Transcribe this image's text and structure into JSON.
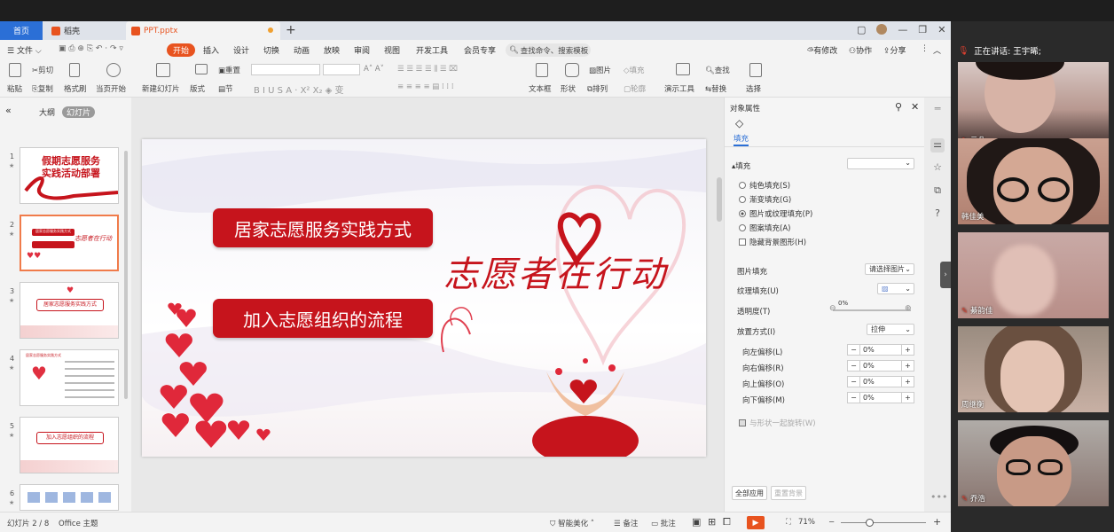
{
  "tabs": {
    "home": "首页",
    "daoke": "稻壳",
    "file": "PPT.pptx"
  },
  "menu": {
    "file": "文件",
    "items": [
      "开始",
      "插入",
      "设计",
      "切换",
      "动画",
      "放映",
      "审阅",
      "视图",
      "开发工具",
      "会员专享"
    ],
    "search": "查找命令、搜索模板",
    "right": [
      "有修改",
      "协作",
      "分享"
    ]
  },
  "ribbon": {
    "paste": "粘贴",
    "cut": "剪切",
    "copy": "复制",
    "format_painter": "格式刷",
    "from_current": "当页开始",
    "new_slide": "新建幻灯片",
    "layout": "版式",
    "section": "节",
    "reset": "重置",
    "textbox": "文本框",
    "shape": "形状",
    "arrange": "排列",
    "picture": "图片",
    "fill": "填充",
    "outline": "轮廓",
    "presenter": "演示工具",
    "find": "查找",
    "replace": "替换",
    "select": "选择"
  },
  "left": {
    "outline": "大纲",
    "slides": "幻灯片"
  },
  "thumbs": [
    {
      "num": "1",
      "t1": "假期志愿服务",
      "t2": "实践活动部署"
    },
    {
      "num": "2",
      "t1": "居家志愿服务实践方式",
      "t2": "志愿者在行动"
    },
    {
      "num": "3",
      "t1": "居家志愿服务实践方式"
    },
    {
      "num": "4",
      "t1": "居家志愿服务实践方式"
    },
    {
      "num": "5",
      "t1": "加入志愿组织的流程"
    },
    {
      "num": "6"
    }
  ],
  "slide": {
    "pill1": "居家志愿服务实践方式",
    "pill2": "加入志愿组织的流程",
    "calligraphy": "志愿者在行动"
  },
  "props": {
    "title": "对象属性",
    "tab_fill": "填充",
    "section_fill": "填充",
    "options": [
      "纯色填充(S)",
      "渐变填充(G)",
      "图片或纹理填充(P)",
      "图案填充(A)"
    ],
    "hide_bg": "隐藏背景图形(H)",
    "pic_fill": "图片填充",
    "pic_fill_value": "请选择图片",
    "texture_fill": "纹理填充(U)",
    "transparency": "透明度(T)",
    "transparency_value": "0%",
    "placement": "放置方式(I)",
    "placement_value": "拉伸",
    "offsets": [
      {
        "label": "向左偏移(L)",
        "value": "0%"
      },
      {
        "label": "向右偏移(R)",
        "value": "0%"
      },
      {
        "label": "向上偏移(O)",
        "value": "0%"
      },
      {
        "label": "向下偏移(M)",
        "value": "0%"
      }
    ],
    "rotate_with_shape": "与形状一起旋转(W)",
    "apply_all": "全部应用",
    "reset_bg": "重置背景"
  },
  "status": {
    "slide_info": "幻灯片 2 / 8",
    "theme": "Office 主题",
    "beautify": "智能美化",
    "notes": "备注",
    "comments": "批注",
    "zoom": "71%"
  },
  "meeting": {
    "speaking": "正在讲话: 王宇晞;",
    "participants": [
      "云朵",
      "韩佳美",
      "綦韵佳",
      "周继衡",
      "乔浩"
    ]
  },
  "colors": {
    "accent": "#e8531f",
    "slide_red": "#c6141c",
    "home_tab": "#2b6fd6"
  }
}
